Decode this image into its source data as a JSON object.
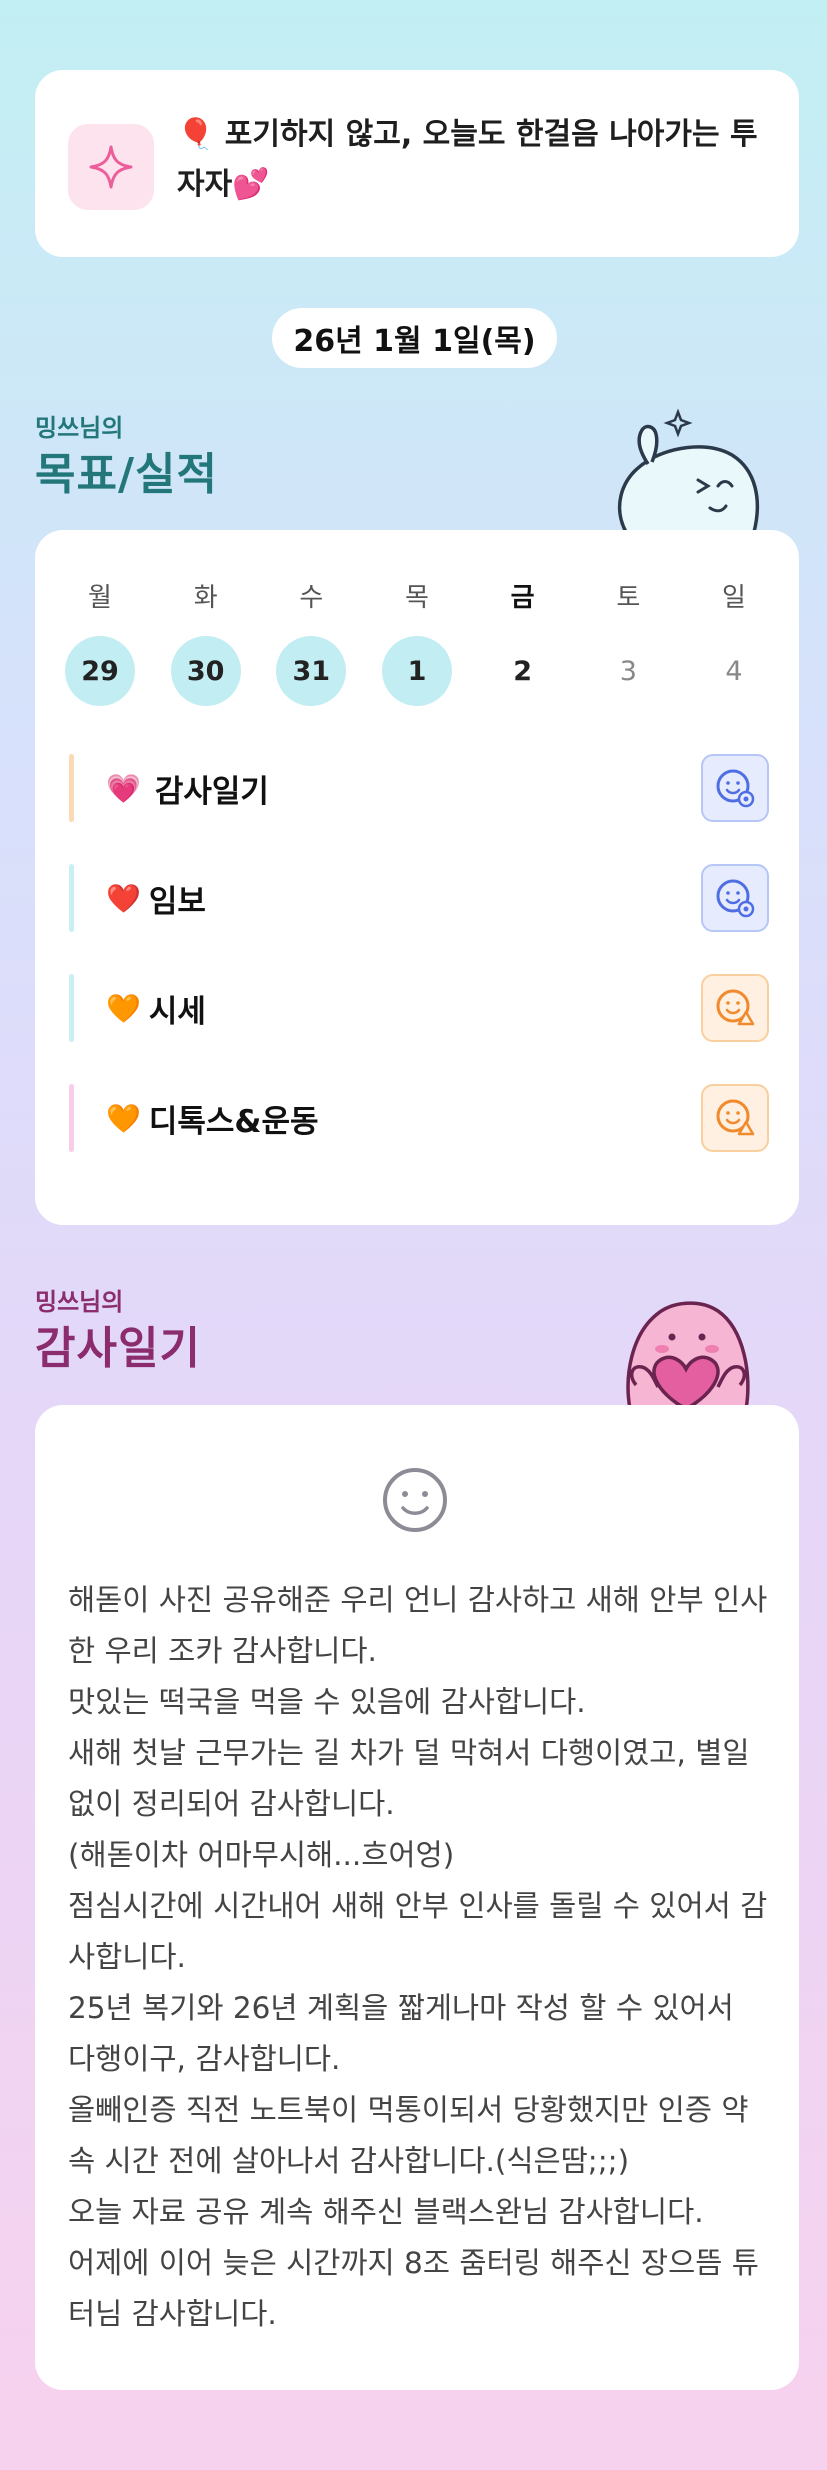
{
  "motto": {
    "icon": "sparkle-icon",
    "text": "🎈 포기하지 않고, 오늘도 한걸음 나아가는 투자자💕"
  },
  "date": "26년 1월 1일(목)",
  "goals_section": {
    "owner": "밍쓰님의",
    "title": "목표/실적"
  },
  "week": {
    "days": [
      {
        "name": "월",
        "num": "29"
      },
      {
        "name": "화",
        "num": "30"
      },
      {
        "name": "수",
        "num": "31"
      },
      {
        "name": "목",
        "num": "1"
      },
      {
        "name": "금",
        "num": "2"
      },
      {
        "name": "토",
        "num": "3"
      },
      {
        "name": "일",
        "num": "4"
      }
    ]
  },
  "goals": [
    {
      "heart": "💗",
      "label": "감사일기",
      "status": "smile-check-icon"
    },
    {
      "heart": "❤️",
      "label": "임보",
      "status": "smile-check-icon"
    },
    {
      "heart": "🧡",
      "label": "시세",
      "status": "smile-warning-icon"
    },
    {
      "heart": "🧡",
      "label": "디톡스&운동",
      "status": "smile-warning-icon"
    }
  ],
  "colors": {
    "accent_teal": "#23777a",
    "accent_plum": "#8a2c6e",
    "done_circle": "#c2edf2"
  },
  "gratitude_section": {
    "owner": "밍쓰님의",
    "title": "감사일기"
  },
  "gratitude": {
    "icon": "smile-face-icon",
    "text": "해돋이 사진 공유해준 우리 언니 감사하고 새해 안부 인사한 우리 조카 감사합니다.\n맛있는 떡국을 먹을 수 있음에 감사합니다.\n새해 첫날 근무가는 길 차가 덜 막혀서 다행이였고, 별일 없이 정리되어 감사합니다.\n(해돋이차 어마무시해...흐어엉)\n점심시간에 시간내어 새해 안부 인사를 돌릴 수 있어서 감사합니다.\n25년 복기와 26년 계획을 짧게나마 작성 할 수 있어서 다행이구, 감사합니다.\n올빼인증 직전 노트북이 먹통이되서 당황했지만 인증 약속 시간 전에 살아나서 감사합니다.(식은땀;;;)\n오늘 자료 공유 계속 해주신 블랙스완님 감사합니다.\n어제에 이어 늦은 시간까지 8조 줌터링 해주신 장으뜸 튜터님 감사합니다."
  }
}
